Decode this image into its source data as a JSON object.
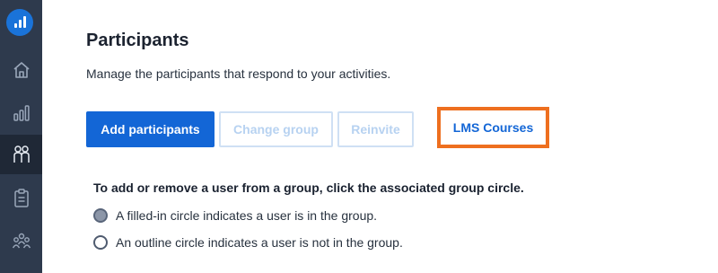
{
  "sidebar": {
    "logo_icon": "bar-chart-logo-icon",
    "items": [
      {
        "name": "home",
        "icon": "home-icon",
        "active": false
      },
      {
        "name": "reports",
        "icon": "bar-chart-icon",
        "active": false
      },
      {
        "name": "participants",
        "icon": "people-icon",
        "active": true
      },
      {
        "name": "activities",
        "icon": "clipboard-icon",
        "active": false
      },
      {
        "name": "groups",
        "icon": "group-icon",
        "active": false
      }
    ]
  },
  "page": {
    "title": "Participants",
    "subtitle": "Manage the participants that respond to your activities."
  },
  "buttons": {
    "add": "Add participants",
    "change_group": "Change group",
    "reinvite": "Reinvite",
    "lms": "LMS Courses"
  },
  "instructions": {
    "heading": "To add or remove a user from a group, click the associated group circle.",
    "filled": "A filled-in circle indicates a user is in the group.",
    "outline": "An outline circle indicates a user is not in the group."
  },
  "colors": {
    "primary": "#1366d6",
    "sidebar": "#2e3a4d",
    "highlight": "#ee6f1f"
  }
}
